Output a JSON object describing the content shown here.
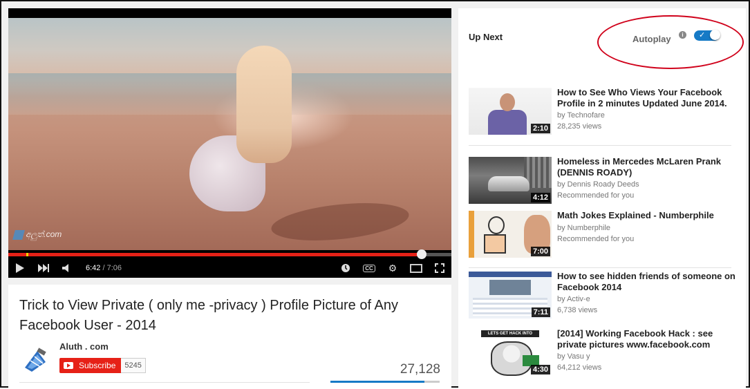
{
  "player": {
    "current_time": "6:42",
    "duration": "/ 7:06",
    "progress_fraction": 0.933,
    "watermark": "අලුත්.com"
  },
  "info": {
    "title": "Trick to View Private ( only me -privacy ) Profile Picture of Any Facebook User - 2014",
    "channel_name": "Aluth . com",
    "subscribe_label": "Subscribe",
    "subscriber_count": "5245",
    "view_count": "27,128",
    "like_fraction": 0.86
  },
  "sidebar": {
    "up_next_label": "Up Next",
    "autoplay_label": "Autoplay",
    "autoplay_on": true,
    "videos": [
      {
        "title": "How to See Who Views Your Facebook Profile in 2 minutes Updated June 2014.",
        "channel": "by Technofare",
        "meta": "28,235 views",
        "duration": "2:10"
      },
      {
        "title": "Homeless in Mercedes McLaren Prank (DENNIS ROADY)",
        "channel": "by Dennis Roady Deeds",
        "meta": "Recommended for you",
        "duration": "4:12"
      },
      {
        "title": "Math Jokes Explained - Numberphile",
        "channel": "by Numberphile",
        "meta": "Recommended for you",
        "duration": "7:00"
      },
      {
        "title": "How to see hidden friends of someone on Facebook 2014",
        "channel": "by Activ-e",
        "meta": "6,738 views",
        "duration": "7:11"
      },
      {
        "title": "[2014] Working Facebook Hack : see private pictures www.facebook.com",
        "channel": "by Vasu y",
        "meta": "64,212 views",
        "duration": "4:30",
        "thumb_text": "LETS GET HACK INTO FACEBOOK"
      }
    ]
  },
  "colors": {
    "accent_red": "#e62117",
    "toggle_blue": "#167ac6",
    "highlight": "#d0021b"
  },
  "icons": [
    "play-icon",
    "next-icon",
    "volume-icon",
    "watch-later-icon",
    "captions-icon",
    "settings-icon",
    "theater-icon",
    "fullscreen-icon",
    "info-icon",
    "youtube-logo-icon"
  ]
}
